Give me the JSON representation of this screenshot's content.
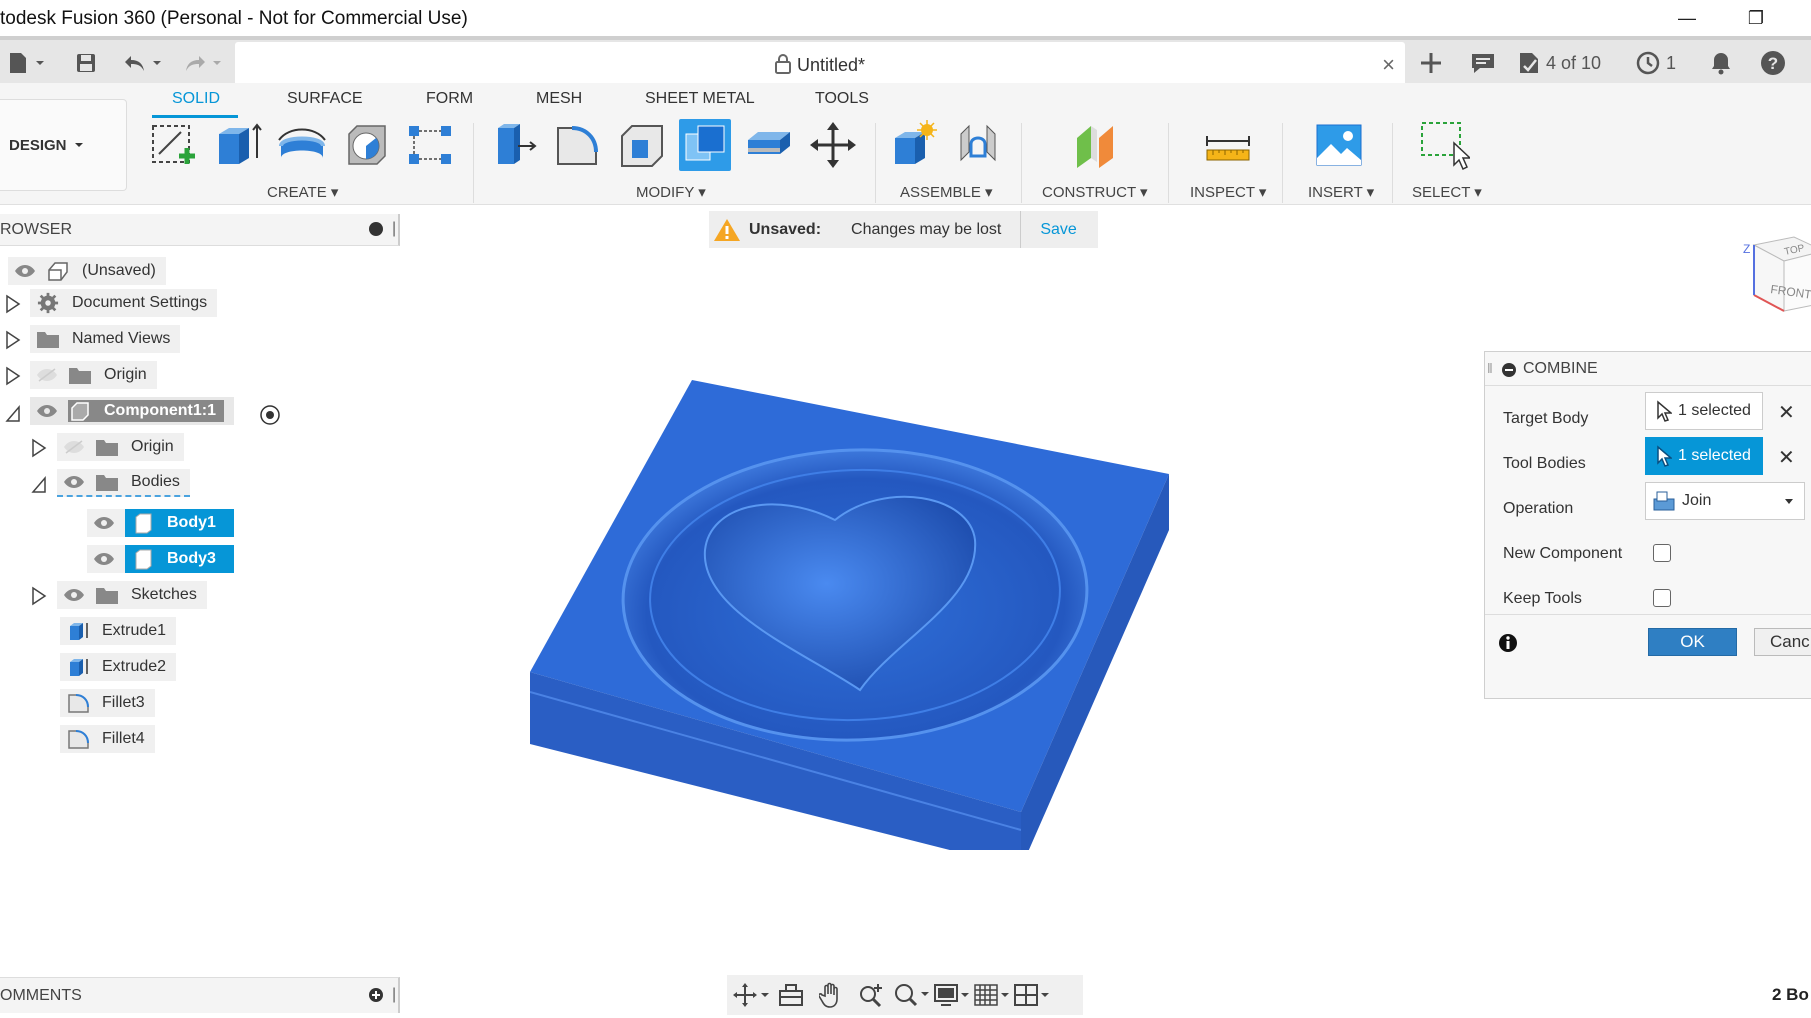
{
  "window": {
    "title": "todesk Fusion 360 (Personal - Not for Commercial Use)",
    "minimize_glyph": "—",
    "restore_glyph": "❐"
  },
  "tabbar": {
    "document_title": "Untitled*",
    "jobs_label": "4 of 10",
    "history_count": "1"
  },
  "ribbon": {
    "workspace": "DESIGN",
    "tabs": [
      "SOLID",
      "SURFACE",
      "FORM",
      "MESH",
      "SHEET METAL",
      "TOOLS"
    ],
    "active_tab": "SOLID",
    "groups": [
      "CREATE",
      "MODIFY",
      "ASSEMBLE",
      "CONSTRUCT",
      "INSPECT",
      "INSERT",
      "SELECT"
    ],
    "accent": "#0696d7"
  },
  "browser": {
    "header": "ROWSER",
    "nodes": [
      {
        "label": "(Unsaved)"
      },
      {
        "label": "Document Settings"
      },
      {
        "label": "Named Views"
      },
      {
        "label": "Origin"
      },
      {
        "label": "Component1:1"
      },
      {
        "label": "Origin"
      },
      {
        "label": "Bodies"
      },
      {
        "label": "Body1"
      },
      {
        "label": "Body3"
      },
      {
        "label": "Sketches"
      },
      {
        "label": "Extrude1"
      },
      {
        "label": "Extrude2"
      },
      {
        "label": "Fillet3"
      },
      {
        "label": "Fillet4"
      }
    ]
  },
  "unsaved_banner": {
    "title": "Unsaved:",
    "message": "Changes may be lost",
    "action": "Save"
  },
  "viewcube": {
    "top": "TOP",
    "front": "FRONT",
    "axis_z": "Z"
  },
  "combine_dialog": {
    "title": "COMBINE",
    "target_body_label": "Target Body",
    "target_body_value": "1 selected",
    "tool_bodies_label": "Tool Bodies",
    "tool_bodies_value": "1 selected",
    "operation_label": "Operation",
    "operation_value": "Join",
    "new_component_label": "New Component",
    "keep_tools_label": "Keep Tools",
    "ok_label": "OK",
    "cancel_label": "Canc"
  },
  "comments": {
    "header": "OMMENTS"
  },
  "status": {
    "right_text": "2 Bo"
  },
  "colors": {
    "model_blue": "#2e6bd8",
    "selection_blue": "#0696d7",
    "ok_blue": "#2f7fc3"
  }
}
